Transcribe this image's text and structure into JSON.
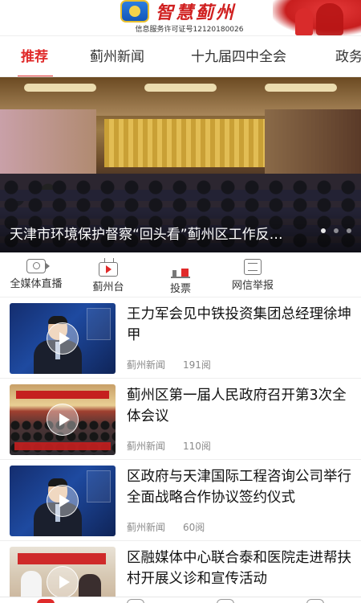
{
  "header": {
    "app_name": "智慧蓟州",
    "license": "信息服务许可证号12120180026"
  },
  "tabs": [
    {
      "label": "推荐",
      "active": true
    },
    {
      "label": "蓟州新闻",
      "active": false
    },
    {
      "label": "十九届四中全会",
      "active": false
    },
    {
      "label": "政务",
      "active": false
    }
  ],
  "banner": {
    "caption": "天津市环境保护督察“回头看”蓟州区工作反…",
    "slides_count": 3,
    "active_slide": 1
  },
  "quicknav": [
    {
      "label": "全媒体直播",
      "icon": "live-camera-icon"
    },
    {
      "label": "蓟州台",
      "icon": "tv-icon"
    },
    {
      "label": "投票",
      "icon": "vote-chart-icon"
    },
    {
      "label": "网信举报",
      "icon": "report-list-icon"
    }
  ],
  "news": [
    {
      "title": "王力军会见中铁投资集团总经理徐坤甲",
      "source": "蓟州新闻",
      "views": "191阅",
      "thumb": "studio"
    },
    {
      "title": "蓟州区第一届人民政府召开第3次全体会议",
      "source": "蓟州新闻",
      "views": "110阅",
      "thumb": "meeting"
    },
    {
      "title": "区政府与天津国际工程咨询公司举行全面战略合作协议签约仪式",
      "source": "蓟州新闻",
      "views": "60阅",
      "thumb": "studio"
    },
    {
      "title": "区融媒体中心联合泰和医院走进帮扶村开展义诊和宣传活动",
      "source": "",
      "views": "",
      "thumb": "clinic"
    }
  ],
  "colors": {
    "accent": "#e02a2a",
    "muted_text": "#8a8a8a"
  }
}
